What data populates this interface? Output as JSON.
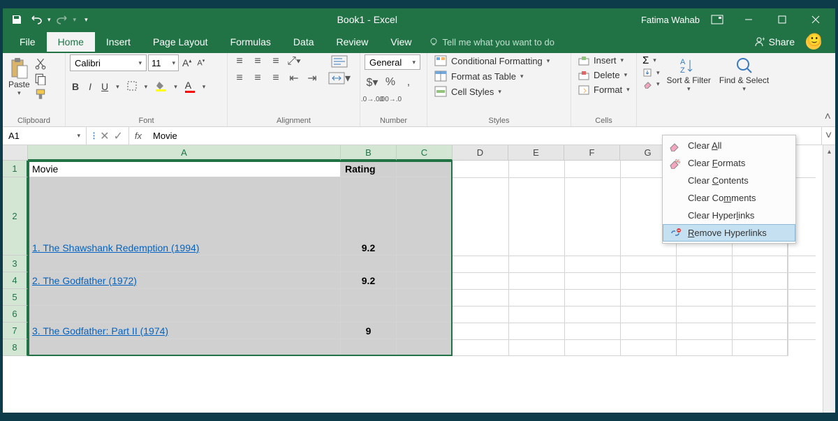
{
  "titlebar": {
    "title": "Book1 - Excel",
    "user": "Fatima Wahab"
  },
  "tabs": {
    "file": "File",
    "home": "Home",
    "insert": "Insert",
    "pagelayout": "Page Layout",
    "formulas": "Formulas",
    "data": "Data",
    "review": "Review",
    "view": "View",
    "tellme": "Tell me what you want to do",
    "share": "Share"
  },
  "ribbon": {
    "clipboard": {
      "label": "Clipboard",
      "paste": "Paste"
    },
    "font": {
      "label": "Font",
      "name": "Calibri",
      "size": "11"
    },
    "alignment": {
      "label": "Alignment"
    },
    "number": {
      "label": "Number",
      "format": "General"
    },
    "styles": {
      "label": "Styles",
      "conditional": "Conditional Formatting",
      "table": "Format as Table",
      "cell": "Cell Styles"
    },
    "cells": {
      "label": "Cells",
      "insert": "Insert",
      "delete": "Delete",
      "format": "Format"
    },
    "editing": {
      "sort": "Sort & Filter",
      "find": "Find & Select"
    }
  },
  "clear_menu": {
    "all": "Clear All",
    "formats": "Clear Formats",
    "contents": "Clear Contents",
    "comments": "Clear Comments",
    "hyperlinks": "Clear Hyperlinks",
    "remove": "Remove Hyperlinks"
  },
  "formula_bar": {
    "namebox": "A1",
    "content": "Movie"
  },
  "columns": [
    "A",
    "B",
    "C",
    "D",
    "E",
    "F",
    "G"
  ],
  "rows": [
    "1",
    "2",
    "3",
    "4",
    "5",
    "6",
    "7",
    "8"
  ],
  "data": {
    "a1": "Movie",
    "b1": "Rating",
    "a2": "1. The Shawshank Redemption (1994)",
    "b2": "9.2",
    "a4": "2. The Godfather (1972)",
    "b4": "9.2",
    "a7": "3. The Godfather: Part II (1974)",
    "b7": "9"
  }
}
